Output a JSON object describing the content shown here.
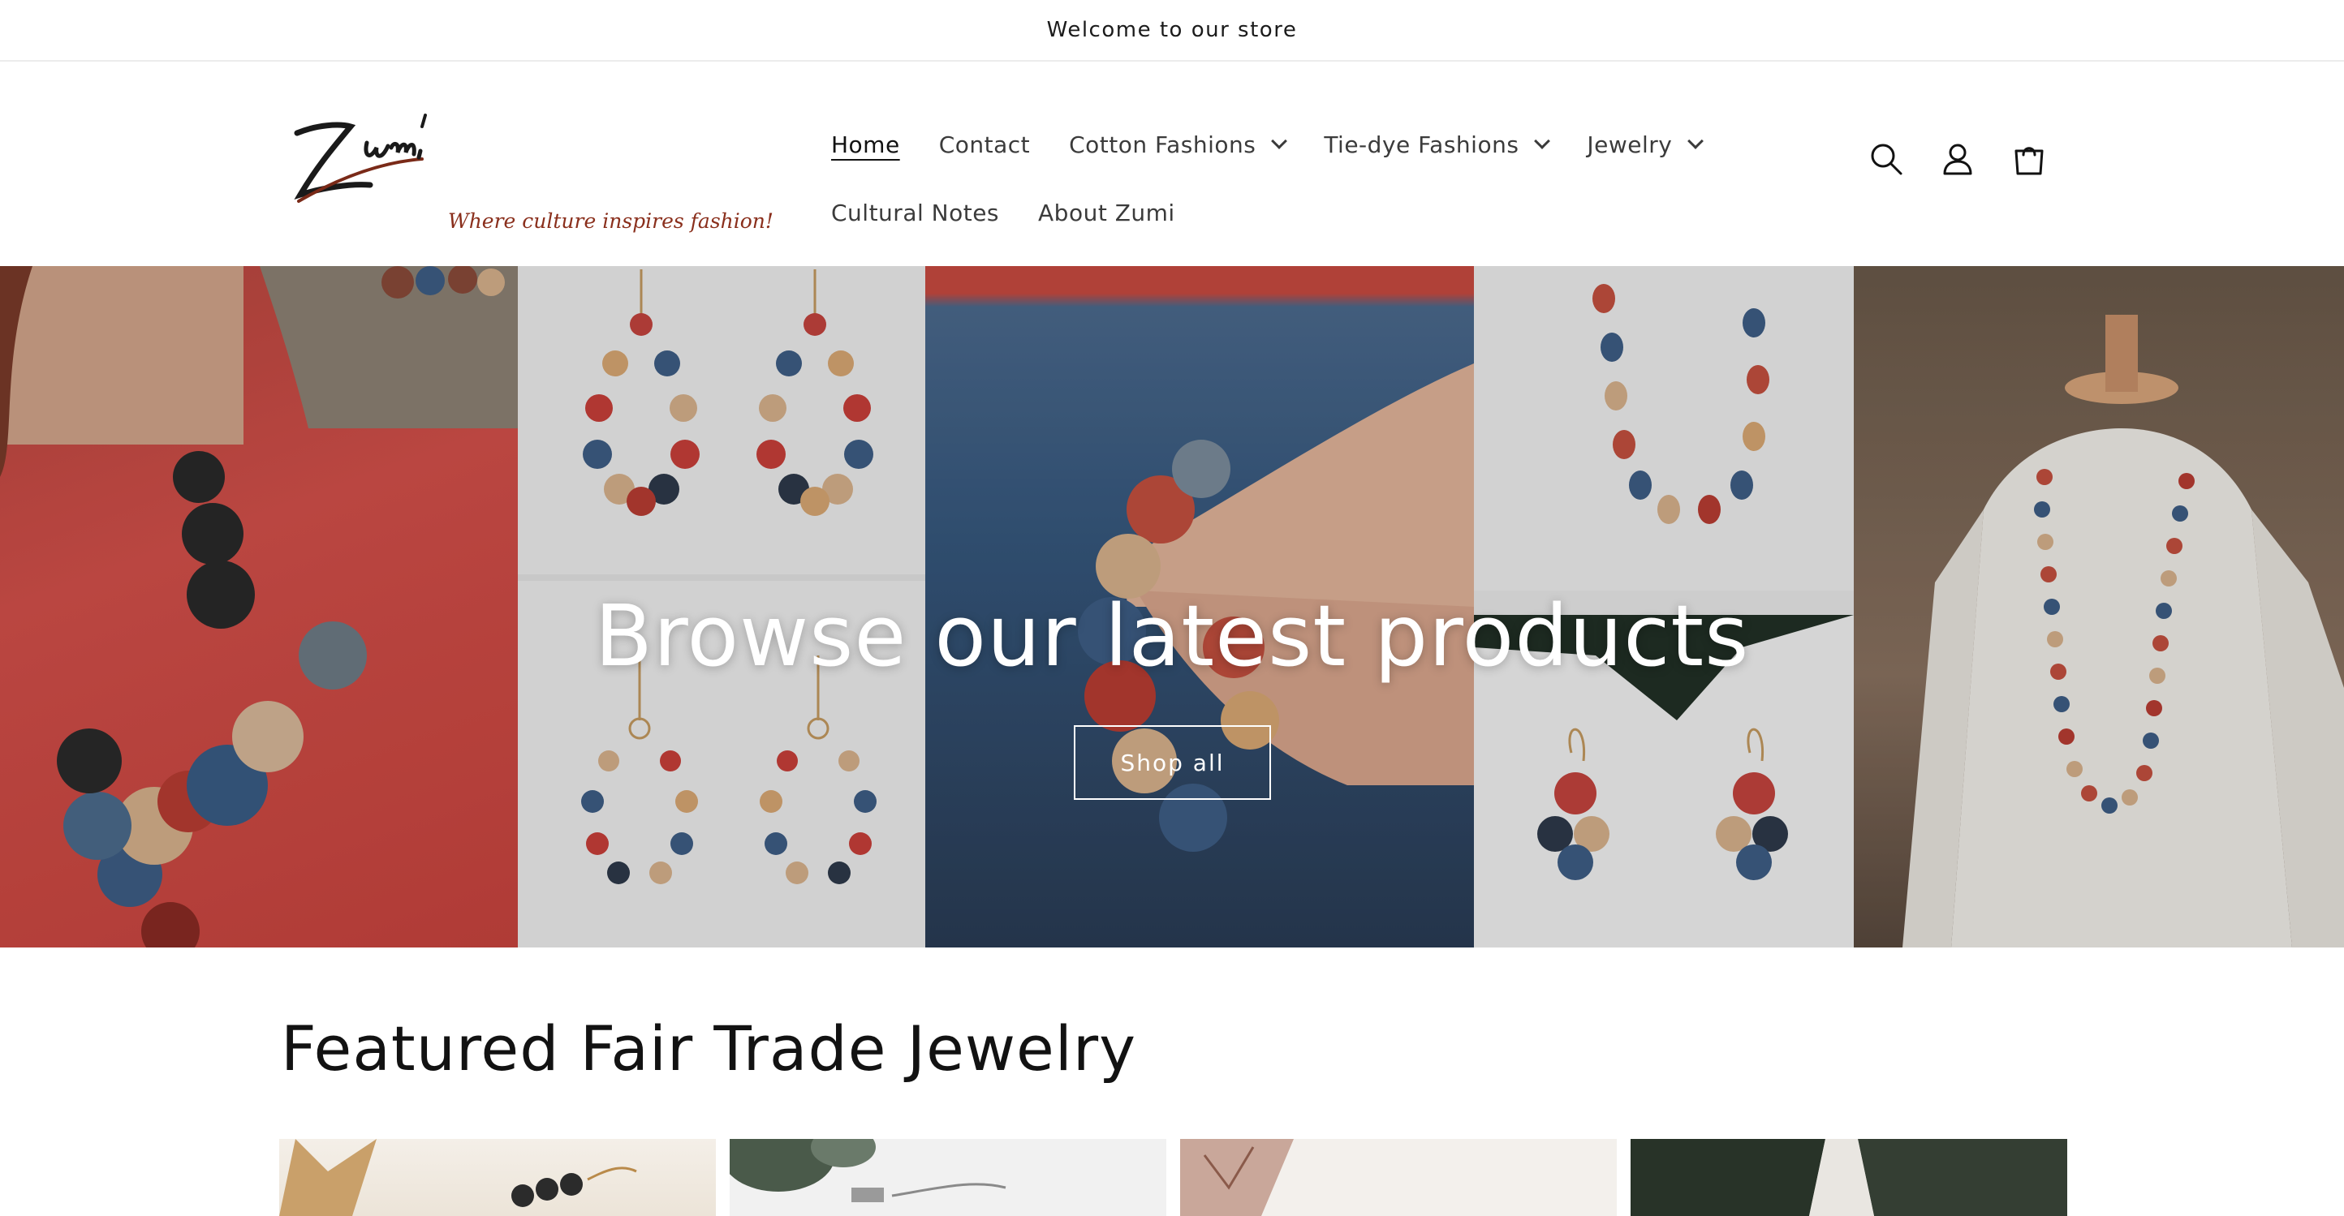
{
  "announcement": "Welcome to our store",
  "logo": {
    "wordmark": "Zumi",
    "tagline": "Where culture inspires fashion!"
  },
  "nav": {
    "row1": [
      {
        "label": "Home",
        "active": true,
        "dropdown": false
      },
      {
        "label": "Contact",
        "active": false,
        "dropdown": false
      },
      {
        "label": "Cotton Fashions",
        "active": false,
        "dropdown": true
      },
      {
        "label": "Tie-dye Fashions",
        "active": false,
        "dropdown": true
      },
      {
        "label": "Jewelry",
        "active": false,
        "dropdown": true
      }
    ],
    "row2": [
      {
        "label": "Cultural Notes",
        "active": false,
        "dropdown": false
      },
      {
        "label": "About Zumi",
        "active": false,
        "dropdown": false
      }
    ]
  },
  "header_icons": [
    "search-icon",
    "account-icon",
    "cart-icon"
  ],
  "hero": {
    "title": "Browse our latest products",
    "button": "Shop all"
  },
  "featured": {
    "heading": "Featured Fair Trade Jewelry"
  },
  "colors": {
    "text": "#121212",
    "nav_text": "#3b3b3b",
    "tagline": "#8a2f1c",
    "hero_text": "#ffffff"
  }
}
